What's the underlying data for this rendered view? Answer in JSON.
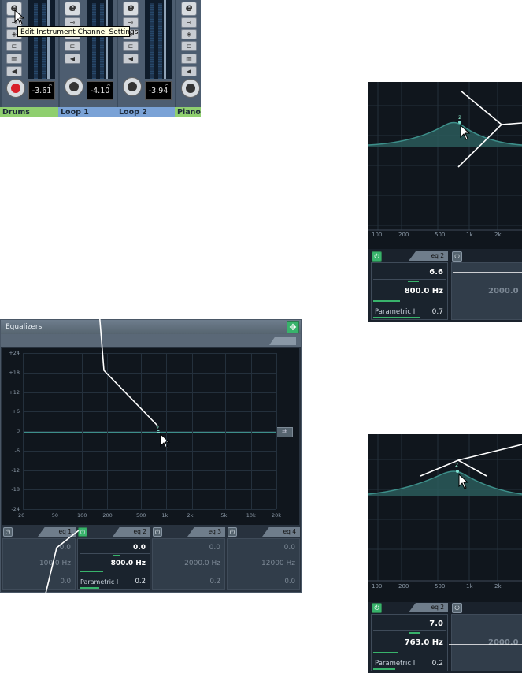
{
  "mixer": {
    "tooltip": "Edit Instrument Channel Settings",
    "channels": [
      {
        "name": "Drums",
        "value": "-3.61",
        "color": "#8fcf6f",
        "record_active": true
      },
      {
        "name": "Loop 1",
        "value": "-4.10",
        "color": "#7aa2d6",
        "record_active": false
      },
      {
        "name": "Loop 2",
        "value": "-3.94",
        "color": "#7aa2d6",
        "record_active": false
      },
      {
        "name": "Piano",
        "value": "",
        "color": "#8fcf6f",
        "record_active": false
      }
    ],
    "edit_glyph": "e"
  },
  "eq_panel": {
    "title": "Equalizers",
    "y_ticks": [
      "+24",
      "+18",
      "+12",
      "+6",
      "0",
      "-6",
      "-12",
      "-18",
      "-24"
    ],
    "x_ticks": [
      "20",
      "50",
      "100",
      "200",
      "500",
      "1k",
      "2k",
      "5k",
      "10k",
      "20k"
    ],
    "point_label": "2",
    "bands": [
      {
        "name": "eq 1",
        "gain": "0.0",
        "freq": "100.0 Hz",
        "q": "0.0",
        "active": false,
        "type": ""
      },
      {
        "name": "eq 2",
        "gain": "0.0",
        "freq": "800.0 Hz",
        "q": "0.2",
        "active": true,
        "type": "Parametric I"
      },
      {
        "name": "eq 3",
        "gain": "0.0",
        "freq": "2000.0 Hz",
        "q": "0.2",
        "active": false,
        "type": ""
      },
      {
        "name": "eq 4",
        "gain": "0.0",
        "freq": "12000 Hz",
        "q": "0.0",
        "active": false,
        "type": ""
      }
    ]
  },
  "zoom_top": {
    "x_ticks": [
      "100",
      "200",
      "500",
      "1k",
      "2k"
    ],
    "point_label": "2",
    "band": {
      "name": "eq 2",
      "gain": "6.6",
      "freq": "800.0 Hz",
      "type": "Parametric I",
      "q": "0.7"
    },
    "next_band_freq": "2000.0"
  },
  "zoom_bottom": {
    "x_ticks": [
      "100",
      "200",
      "500",
      "1k",
      "2k"
    ],
    "point_label": "2",
    "band": {
      "name": "eq 2",
      "gain": "7.0",
      "freq": "763.0 Hz",
      "type": "Parametric I",
      "q": "0.2"
    },
    "next_band_freq": "2000.0"
  },
  "colors": {
    "accent_green": "#38b36b",
    "curve": "#3d8f8a",
    "fill": "#2a5a5a"
  }
}
